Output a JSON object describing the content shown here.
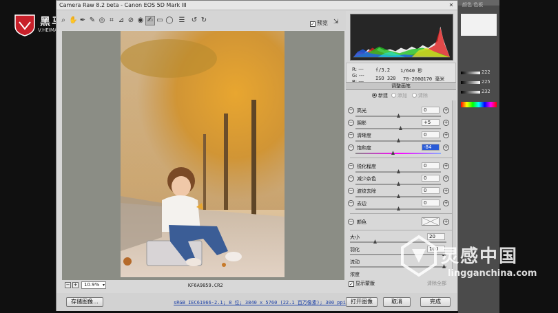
{
  "window": {
    "title": "Camera Raw 8.2 beta - Canon EOS 5D Mark III"
  },
  "branding": {
    "text": "黑马",
    "url": "V.HEIMAVIDEO.COM"
  },
  "toolbar": {
    "preview_label": "预览",
    "preview_checked": "✓"
  },
  "status": {
    "zoom": "10.9%",
    "filename": "KF6A9859.CR2"
  },
  "info": {
    "r": "R:",
    "g": "G:",
    "b": "B:",
    "r_val": "---",
    "g_val": "---",
    "b_val": "---",
    "aperture": "f/3.2",
    "shutter": "1/640 秒",
    "iso": "ISO 320",
    "lens": "70-200@170 毫米"
  },
  "panel": {
    "title": "调整画笔",
    "mode_new": "新建",
    "mode_add": "添加",
    "mode_clear": "清除",
    "sliders": [
      {
        "label": "高光",
        "value": "0"
      },
      {
        "label": "阴影",
        "value": "+5"
      },
      {
        "label": "清晰度",
        "value": "0"
      },
      {
        "label": "饱和度",
        "value": "-84"
      },
      {
        "label": "锐化程度",
        "value": "0"
      },
      {
        "label": "减少杂色",
        "value": "0"
      },
      {
        "label": "波纹去除",
        "value": "0"
      },
      {
        "label": "去边",
        "value": "0"
      }
    ],
    "color_label": "颜色",
    "brush": [
      {
        "label": "大小",
        "value": "20"
      },
      {
        "label": "羽化",
        "value": "100"
      },
      {
        "label": "流动",
        "value": ""
      },
      {
        "label": "浓度",
        "value": ""
      }
    ],
    "show_mask": "显示蒙版",
    "show_mask_checked": "✓",
    "clear_all": "清除全部"
  },
  "buttons": {
    "save": "存储图像...",
    "open": "打开图像",
    "cancel": "取消",
    "done": "完成"
  },
  "workflow_link": "sRGB IEC61966-2.1; 8 位; 3840 x 5760 (22.1 百万像素); 300 ppi",
  "watermark": {
    "cn": "灵感中国",
    "en": "lingganchina.com"
  },
  "photoshop_strip": {
    "tab": "颜色 色板",
    "values": [
      "222",
      "225",
      "232"
    ]
  },
  "icons": [
    "zoom-icon",
    "hand-icon",
    "white-balance-icon",
    "color-sampler-icon",
    "target-adjust-icon",
    "crop-icon",
    "straighten-icon",
    "spot-removal-icon",
    "red-eye-icon",
    "adjustment-brush-icon",
    "graduated-filter-icon",
    "radial-filter-icon",
    "preferences-icon",
    "rotate-left-icon",
    "rotate-right-icon"
  ]
}
